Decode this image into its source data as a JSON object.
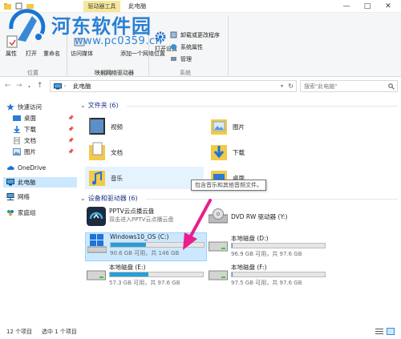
{
  "titlebar": {
    "context_tab": "驱动器工具",
    "title": "此电脑",
    "min": "—",
    "max": "□",
    "close": "✕"
  },
  "watermark": {
    "text": "河东软件园",
    "url": "www.pc0359.cn"
  },
  "ribbon": {
    "location_group": {
      "label": "位置",
      "buttons": [
        "属性",
        "打开",
        "重命名"
      ]
    },
    "network_group": {
      "label": "网络",
      "buttons": [
        "访问媒体",
        "映射网络驱动器",
        "添加一个网络位置"
      ]
    },
    "system_group": {
      "label": "系统",
      "open_settings": "打开设置",
      "items": [
        "卸载或更改程序",
        "系统属性",
        "管理"
      ]
    }
  },
  "address": {
    "path": "此电脑",
    "search_placeholder": "搜索\"此电脑\""
  },
  "nav": {
    "quick_access": "快速访问",
    "items": [
      {
        "label": "桌面",
        "pinned": true
      },
      {
        "label": "下载",
        "pinned": true
      },
      {
        "label": "文档",
        "pinned": true
      },
      {
        "label": "图片",
        "pinned": true
      }
    ],
    "onedrive": "OneDrive",
    "this_pc": "此电脑",
    "network": "网络",
    "homegroup": "家庭组"
  },
  "content": {
    "folders_header": "文件夹 (6)",
    "folders": [
      "视频",
      "图片",
      "文档",
      "下载",
      "音乐",
      "桌面"
    ],
    "tooltip": "包含音乐和其他音频文件。",
    "drives_header": "设备和驱动器 (6)",
    "drives": [
      {
        "name": "PPTV云点播云盘",
        "info": "双击进入PPTV云点播云盘",
        "used_fraction": null
      },
      {
        "name": "DVD RW 驱动器 (Y:)",
        "info": "",
        "used_fraction": null
      },
      {
        "name": "Windows10_OS (C:)",
        "info": "90.6 GB 可用，共 146 GB",
        "used_fraction": 0.38
      },
      {
        "name": "本地磁盘 (D:)",
        "info": "96.9 GB 可用，共 97.6 GB",
        "used_fraction": 0.01
      },
      {
        "name": "本地磁盘 (E:)",
        "info": "57.3 GB 可用，共 97.6 GB",
        "used_fraction": 0.41
      },
      {
        "name": "本地磁盘 (F:)",
        "info": "97.5 GB 可用，共 97.6 GB",
        "used_fraction": 0.005
      }
    ]
  },
  "status": {
    "count": "12 个项目",
    "selected": "选中 1 个项目"
  },
  "colors": {
    "accent": "#26a0da",
    "selection": "#cce8ff",
    "header_blue": "#1e3287",
    "watermark": "#1976d2",
    "arrow": "#e91e8c"
  }
}
